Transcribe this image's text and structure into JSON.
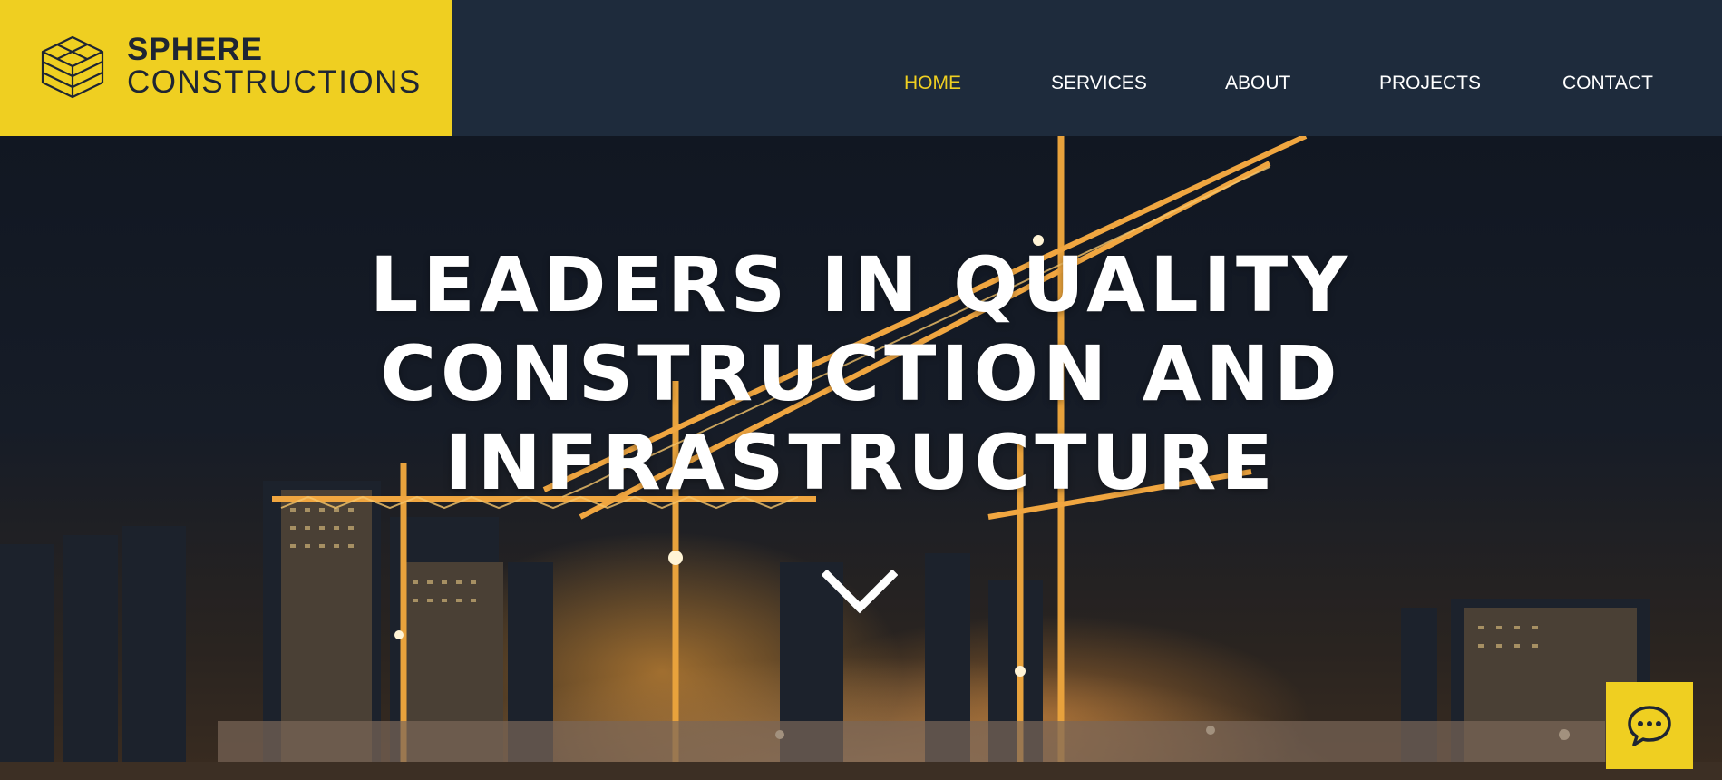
{
  "brand": {
    "name": "SPHERE",
    "subtitle": "CONSTRUCTIONS",
    "accent_color": "#efcf21",
    "header_color": "#1e2b3c",
    "logo_icon": "isometric-layers-icon"
  },
  "nav": {
    "items": [
      {
        "label": "HOME",
        "active": true
      },
      {
        "label": "SERVICES",
        "active": false
      },
      {
        "label": "ABOUT",
        "active": false
      },
      {
        "label": "PROJECTS",
        "active": false
      },
      {
        "label": "CONTACT",
        "active": false
      }
    ]
  },
  "hero": {
    "headline_lines": [
      "LEADERS IN QUALITY",
      "CONSTRUCTION AND",
      "INFRASTRUCTURE"
    ],
    "scroll_icon": "chevron-down-icon",
    "background": "night construction site with tower cranes"
  },
  "chat": {
    "icon": "chat-bubble-icon"
  }
}
